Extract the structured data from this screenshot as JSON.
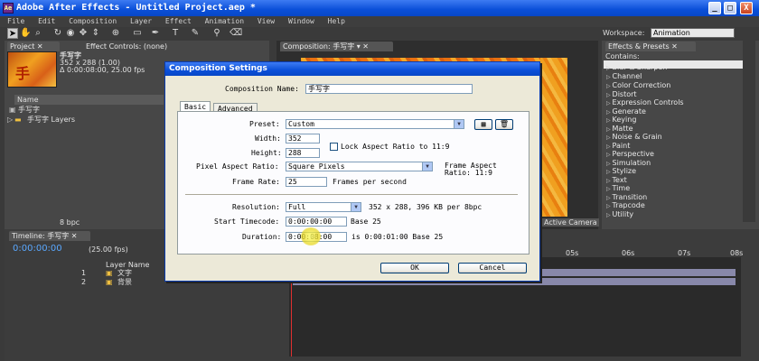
{
  "window": {
    "title": "Adobe After Effects - Untitled Project.aep *",
    "buttons": [
      "_",
      "□",
      "X"
    ]
  },
  "menu": [
    "File",
    "Edit",
    "Composition",
    "Layer",
    "Effect",
    "Animation",
    "View",
    "Window",
    "Help"
  ],
  "workspace": {
    "label": "Workspace:",
    "value": "Animation"
  },
  "project_panel": {
    "tab_project": "Project",
    "tab_effect_controls": "Effect Controls: (none)",
    "comp_name": "手写字",
    "comp_size": "352 x 288 (1.00)",
    "comp_duration": "Δ 0:00:08:00, 25.00 fps",
    "col_name": "Name",
    "items": [
      {
        "name": "手写字",
        "type": "comp"
      },
      {
        "name": "手写字 Layers",
        "type": "folder"
      }
    ],
    "bpc": "8 bpc"
  },
  "comp_panel": {
    "tab": "Composition: 手写字",
    "active_camera": "Active Camera"
  },
  "effects_panel": {
    "tab": "Effects & Presets",
    "contains_label": "Contains:",
    "items": [
      "Blur & Sharpen",
      "Channel",
      "Color Correction",
      "Distort",
      "Expression Controls",
      "Generate",
      "Keying",
      "Matte",
      "Noise & Grain",
      "Paint",
      "Perspective",
      "Simulation",
      "Stylize",
      "Text",
      "Time",
      "Transition",
      "Trapcode",
      "Utility"
    ]
  },
  "timeline": {
    "tab": "Timeline: 手写字",
    "timecode": "0:00:00:00",
    "fps": "(25.00 fps)",
    "col_layer_name": "Layer Name",
    "ruler": [
      "05s",
      "06s",
      "07s",
      "08s"
    ],
    "layers": [
      {
        "num": "1",
        "name": "文字"
      },
      {
        "num": "2",
        "name": "背景"
      }
    ]
  },
  "dialog": {
    "title": "Composition Settings",
    "comp_name_label": "Composition Name:",
    "comp_name_value": "手写字",
    "tabs": [
      "Basic",
      "Advanced"
    ],
    "preset_label": "Preset:",
    "preset_value": "Custom",
    "width_label": "Width:",
    "width_value": "352",
    "height_label": "Height:",
    "height_value": "288",
    "lock_label": "Lock Aspect Ratio to 11:9",
    "par_label": "Pixel Aspect Ratio:",
    "par_value": "Square Pixels",
    "frame_aspect": "Frame Aspect\nRatio: 11:9",
    "framerate_label": "Frame Rate:",
    "framerate_value": "25",
    "framerate_unit": "Frames per second",
    "resolution_label": "Resolution:",
    "resolution_value": "Full",
    "resolution_info": "352 x 288, 396 KB per 8bpc",
    "start_tc_label": "Start Timecode:",
    "start_tc_value": "0:00:00:00",
    "start_tc_base": "Base 25",
    "duration_label": "Duration:",
    "duration_value": "0:00:08:00",
    "duration_info": "is 0:00:01:00  Base 25",
    "ok": "OK",
    "cancel": "Cancel"
  }
}
